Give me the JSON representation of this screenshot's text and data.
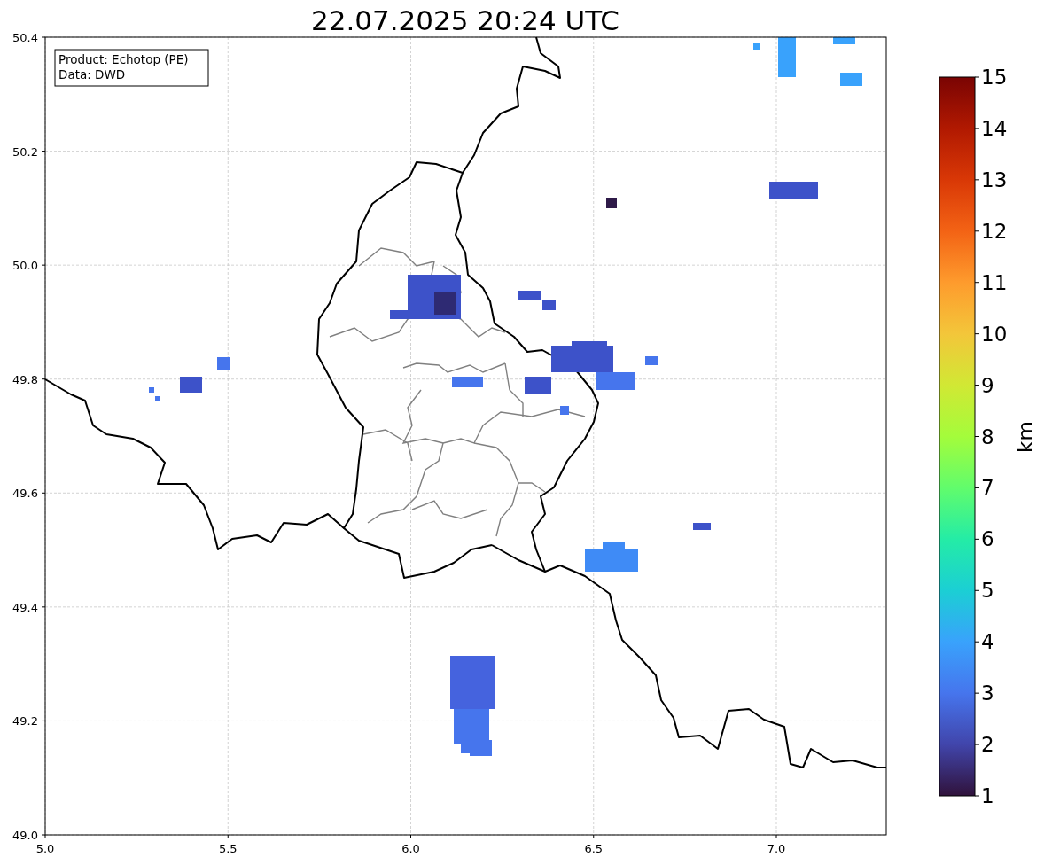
{
  "title": "22.07.2025 20:24 UTC",
  "legend": [
    "Product: Echotop (PE)",
    "Data: DWD"
  ],
  "x_axis": {
    "ticks": [
      "5.0",
      "5.5",
      "6.0",
      "6.5",
      "7.0"
    ]
  },
  "y_axis": {
    "ticks": [
      "50.4",
      "50.2",
      "50.0",
      "49.8",
      "49.6",
      "49.4",
      "49.2",
      "49.0"
    ]
  },
  "colorbar": {
    "label": "km",
    "ticks": [
      "15",
      "14",
      "13",
      "12",
      "11",
      "10",
      "9",
      "8",
      "7",
      "6",
      "5",
      "4",
      "3",
      "2",
      "1"
    ]
  }
}
